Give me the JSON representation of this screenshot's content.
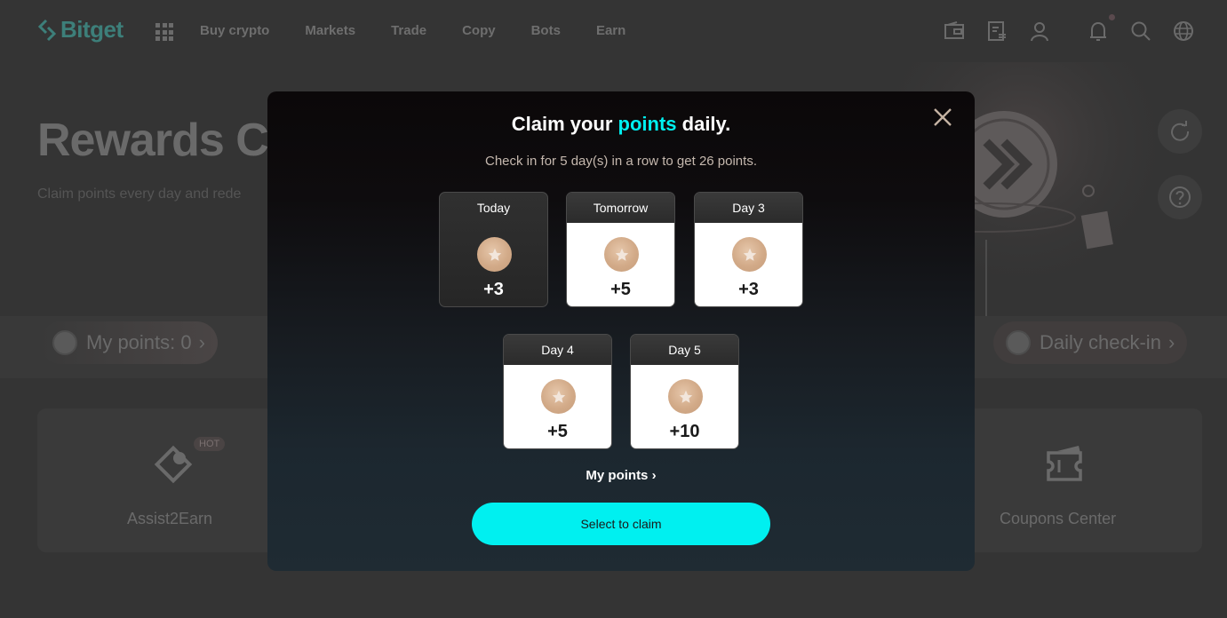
{
  "header": {
    "brand": "Bitget",
    "nav": [
      "Buy crypto",
      "Markets",
      "Trade",
      "Copy",
      "Bots",
      "Earn"
    ],
    "icons": [
      "wallet-icon",
      "orders-icon",
      "user-icon",
      "bell-icon",
      "search-icon",
      "globe-icon"
    ]
  },
  "hero": {
    "title": "Rewards C",
    "subtitle": "Claim points every day and rede"
  },
  "band": {
    "my_points_label": "My points: 0",
    "daily_checkin_label": "Daily check-in",
    "chevron": "›"
  },
  "cards": {
    "left": {
      "label": "Assist2Earn",
      "badge": "HOT"
    },
    "right": {
      "label": "Coupons Center"
    }
  },
  "modal": {
    "title_prefix": "Claim your ",
    "title_accent": "points",
    "title_suffix": " daily.",
    "subtitle": "Check in for 5 day(s) in a row to get 26 points.",
    "days": [
      {
        "label": "Today",
        "points": "+3",
        "state": "current"
      },
      {
        "label": "Tomorrow",
        "points": "+5",
        "state": "upcoming"
      },
      {
        "label": "Day 3",
        "points": "+3",
        "state": "upcoming"
      },
      {
        "label": "Day 4",
        "points": "+5",
        "state": "upcoming"
      },
      {
        "label": "Day 5",
        "points": "+10",
        "state": "upcoming"
      }
    ],
    "my_points_link": "My points ›",
    "claim_button": "Select to claim"
  },
  "colors": {
    "accent": "#00f0f0",
    "brand": "#3d7f7a",
    "subtitle": "#c5b8ae",
    "coin": "#d2aa88"
  }
}
